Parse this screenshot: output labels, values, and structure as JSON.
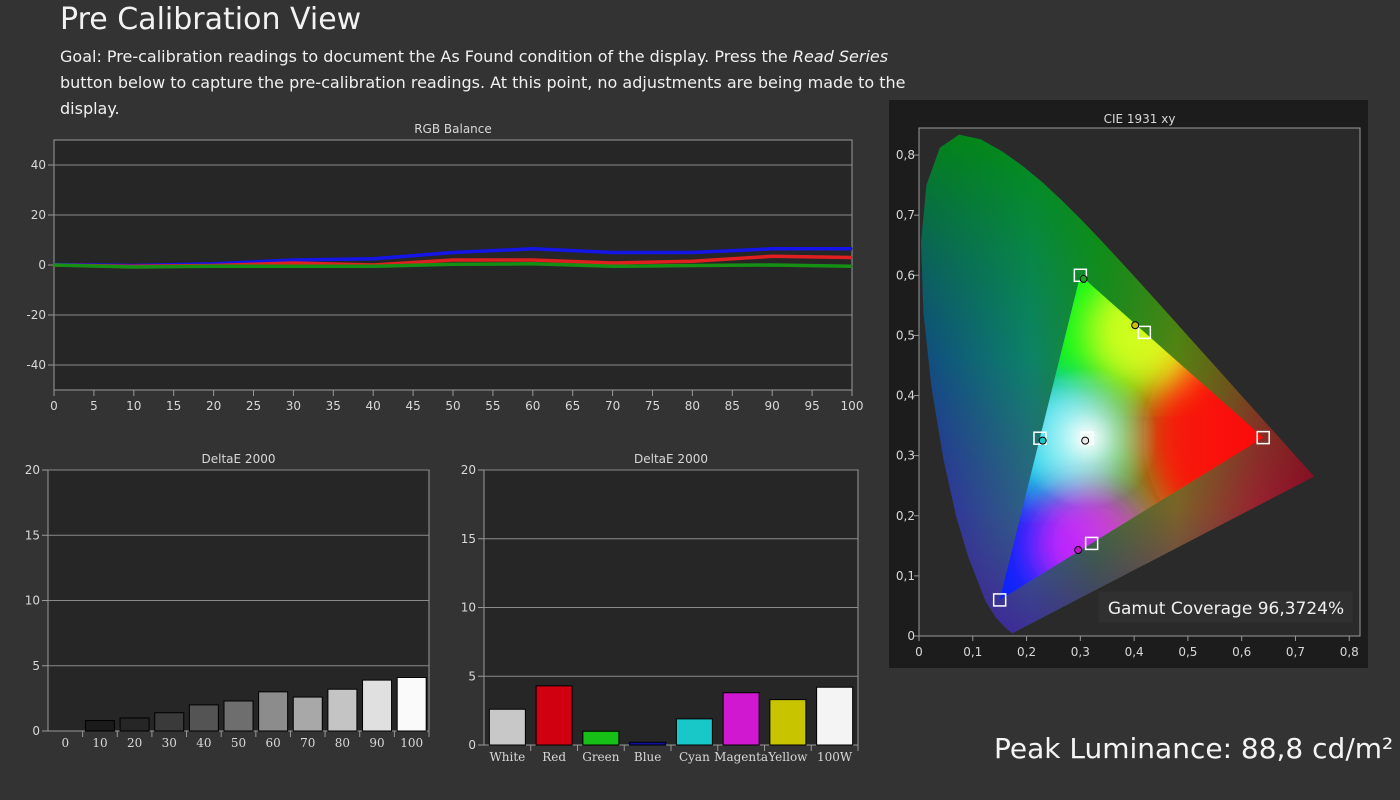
{
  "page": {
    "title": "Pre Calibration View",
    "goal_before": "Goal: Pre-calibration readings to document the As Found condition of the display. Press the ",
    "goal_em": "Read Series",
    "goal_after": " button below to capture the pre-calibration readings. At this point, no adjustments are being made to the display.",
    "peak_luminance": "Peak Luminance: 88,8 cd/m²"
  },
  "chart_data": [
    {
      "id": "rgb",
      "type": "line",
      "title": "RGB Balance",
      "ylim": [
        -50,
        50
      ],
      "xlim": [
        0,
        100
      ],
      "y_ticks": [
        40,
        20,
        0,
        -20,
        -40
      ],
      "y_tick_labels": [
        "40",
        "20",
        "0",
        "-20",
        "-40"
      ],
      "x_ticks": [
        0,
        5,
        10,
        15,
        20,
        25,
        30,
        35,
        40,
        45,
        50,
        55,
        60,
        65,
        70,
        75,
        80,
        85,
        90,
        95,
        100
      ],
      "x": [
        0,
        10,
        20,
        30,
        40,
        50,
        60,
        70,
        80,
        90,
        100
      ],
      "series": [
        {
          "color": "#1515e8",
          "values": [
            0.2,
            -0.2,
            0.5,
            2.0,
            2.5,
            5.0,
            6.5,
            5.0,
            5.0,
            6.5,
            6.5
          ]
        },
        {
          "color": "#e02020",
          "values": [
            0.0,
            -0.5,
            -0.2,
            0.8,
            0.0,
            2.0,
            2.0,
            0.8,
            1.5,
            3.5,
            3.0
          ]
        },
        {
          "color": "#159015",
          "values": [
            0.0,
            -0.8,
            -0.5,
            -0.5,
            -0.5,
            0.3,
            0.5,
            -0.5,
            -0.2,
            0.0,
            -0.5
          ]
        }
      ]
    },
    {
      "id": "de_gray",
      "type": "bar",
      "title": "DeltaE 2000",
      "ylim": [
        0,
        20
      ],
      "y_ticks": [
        20,
        15,
        10,
        5,
        0
      ],
      "categories": [
        "0",
        "10",
        "20",
        "30",
        "40",
        "50",
        "60",
        "70",
        "80",
        "90",
        "100"
      ],
      "values": [
        0.0,
        0.8,
        1.0,
        1.4,
        2.0,
        2.3,
        3.0,
        2.6,
        3.2,
        3.9,
        4.1
      ],
      "colors": [
        "#111111",
        "#1a1a1a",
        "#262626",
        "#3a3a3a",
        "#545454",
        "#6e6e6e",
        "#8c8c8c",
        "#a8a8a8",
        "#c4c4c4",
        "#e0e0e0",
        "#fafafa"
      ]
    },
    {
      "id": "de_color",
      "type": "bar",
      "title": "DeltaE 2000",
      "ylim": [
        0,
        20
      ],
      "y_ticks": [
        20,
        15,
        10,
        5,
        0
      ],
      "categories": [
        "White",
        "Red",
        "Green",
        "Blue",
        "Cyan",
        "Magenta",
        "Yellow",
        "100W"
      ],
      "values": [
        2.6,
        4.3,
        1.0,
        0.2,
        1.9,
        3.8,
        3.3,
        4.2
      ],
      "colors": [
        "#c8c8c8",
        "#d00010",
        "#16c016",
        "#1010a0",
        "#18c8c8",
        "#d018d0",
        "#c8c400",
        "#f4f4f4"
      ]
    },
    {
      "id": "cie",
      "type": "scatter",
      "title": "CIE 1931 xy",
      "xlim": [
        0,
        0.8
      ],
      "ylim": [
        0,
        0.8
      ],
      "x_ticks": [
        0,
        0.1,
        0.2,
        0.3,
        0.4,
        0.5,
        0.6,
        0.7,
        0.8
      ],
      "x_tick_labels": [
        "0",
        "0,1",
        "0,2",
        "0,3",
        "0,4",
        "0,5",
        "0,6",
        "0,7",
        "0,8"
      ],
      "y_ticks": [
        0,
        0.1,
        0.2,
        0.3,
        0.4,
        0.5,
        0.6,
        0.7,
        0.8
      ],
      "y_tick_labels": [
        "0",
        "0,1",
        "0,2",
        "0,3",
        "0,4",
        "0,5",
        "0,6",
        "0,7",
        "0,8"
      ],
      "targets": [
        {
          "x": 0.64,
          "y": 0.33
        },
        {
          "x": 0.3,
          "y": 0.6
        },
        {
          "x": 0.15,
          "y": 0.06
        },
        {
          "x": 0.225,
          "y": 0.329
        },
        {
          "x": 0.321,
          "y": 0.154
        },
        {
          "x": 0.419,
          "y": 0.505
        },
        {
          "x": 0.3127,
          "y": 0.329
        }
      ],
      "measured": [
        {
          "x": 0.306,
          "y": 0.594,
          "color": "#1aa51a"
        },
        {
          "x": 0.402,
          "y": 0.517,
          "color": "#c8c400"
        },
        {
          "x": 0.23,
          "y": 0.325,
          "color": "#18c8c8"
        },
        {
          "x": 0.309,
          "y": 0.325,
          "color": "#e8e8e8"
        },
        {
          "x": 0.296,
          "y": 0.143,
          "color": "#c018c0"
        }
      ],
      "gamut_coverage": "Gamut Coverage 96,3724%"
    }
  ]
}
